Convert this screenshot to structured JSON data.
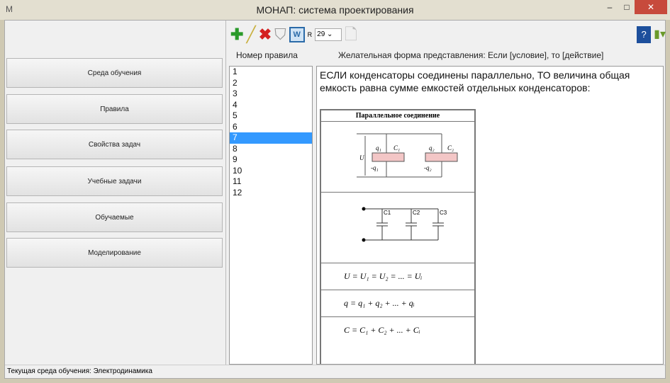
{
  "window": {
    "title": "МОНАП: система проектирования",
    "icon": "M",
    "min": "–",
    "max": "□",
    "close": "✕"
  },
  "nav": [
    "Среда обучения",
    "Правила",
    "Свойства задач",
    "Учебные задачи",
    "Обучаемые",
    "Моделирование"
  ],
  "toolbar": {
    "r_label": "R",
    "font_size": "29"
  },
  "headers": {
    "rule_number": "Номер правила",
    "preferred_form": "Желательная форма представления: Если [условие], то [действие]"
  },
  "rules": [
    "1",
    "2",
    "3",
    "4",
    "5",
    "6",
    "7",
    "8",
    "9",
    "10",
    "11",
    "12"
  ],
  "selected_rule": "7",
  "rule_text": "ЕСЛИ конденсаторы соединены параллельно, ТО величина общая емкость равна сумме емкостей отдельных конденсаторов:",
  "table": {
    "title": "Параллельное соединение",
    "formula1": "U = U₁ = U₂ = ... = Uᵢ",
    "formula2": "q = q₁ + q₂ + ... + qᵢ",
    "formula3": "C = C₁ + C₂ + ... + Cᵢ",
    "labels": {
      "U": "U",
      "q1": "q₁",
      "mq1": "-q₁",
      "C1": "C₁",
      "q2": "q₂",
      "mq2": "-q₂",
      "C2": "C₂",
      "c1": "C1",
      "c2": "C2",
      "c3": "C3"
    }
  },
  "status": "Текущая среда обучения:  Электродинамика"
}
